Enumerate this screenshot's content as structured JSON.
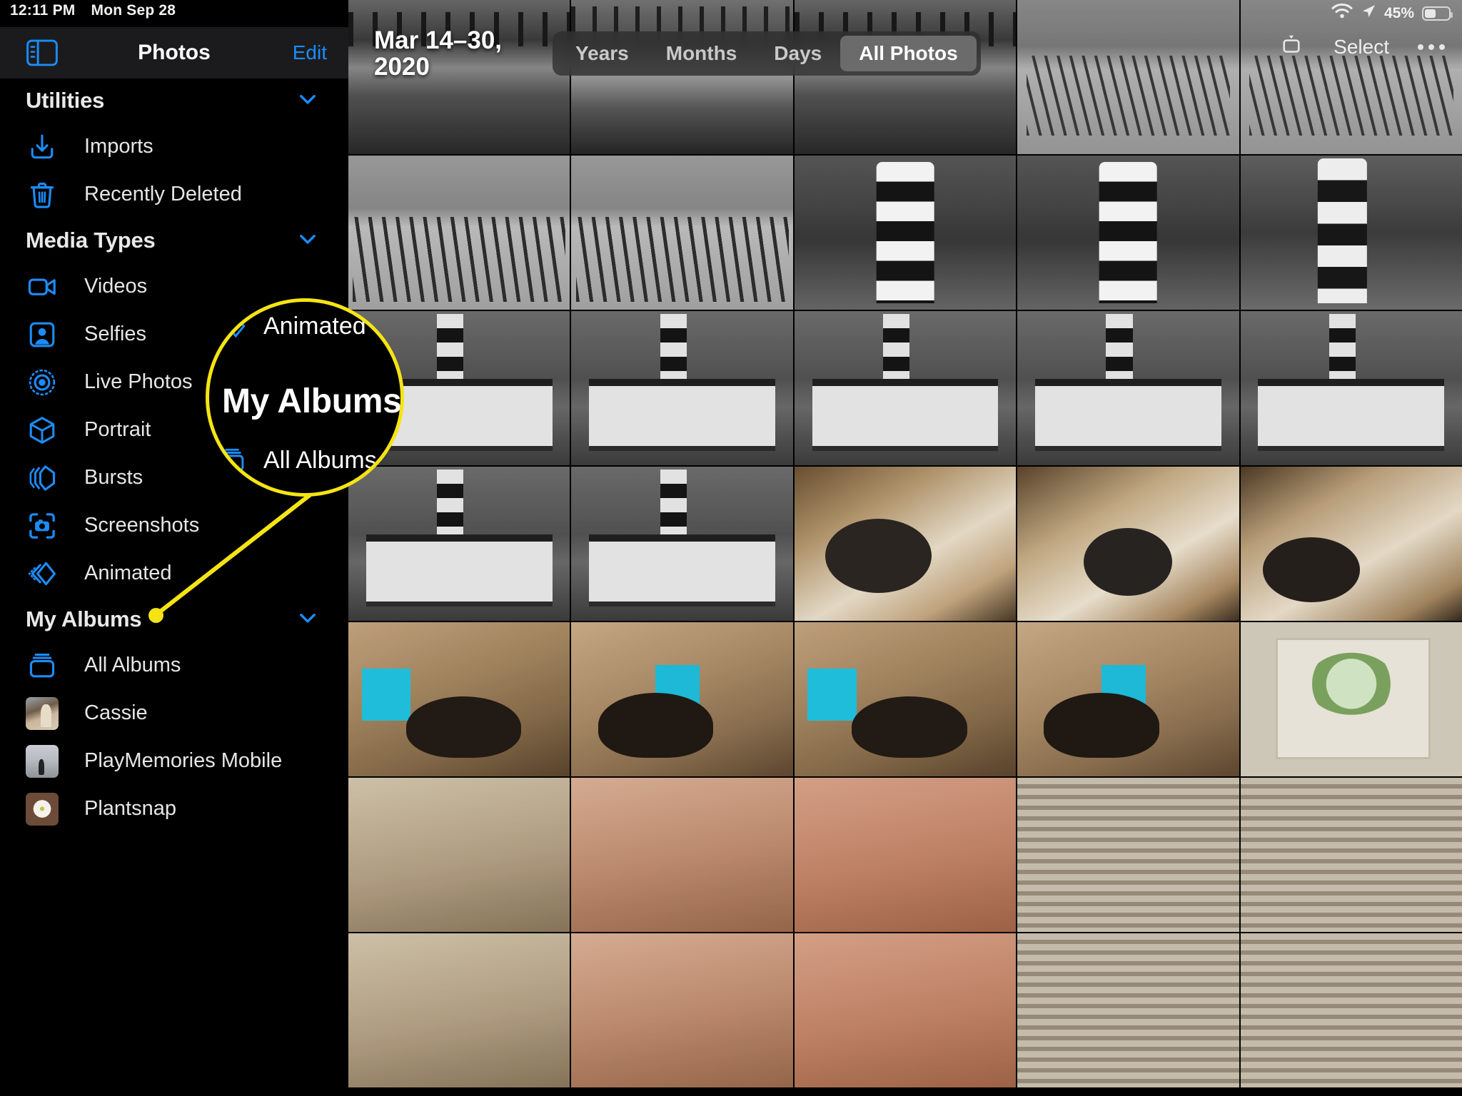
{
  "status_bar": {
    "time": "12:11 PM",
    "date": "Mon Sep 28",
    "battery_percent": "45%",
    "wifi_icon": "wifi-icon",
    "location_icon": "location-arrow-icon",
    "battery_icon": "battery-icon"
  },
  "sidebar": {
    "title": "Photos",
    "edit_label": "Edit",
    "toggle_icon": "sidebar-toggle-icon",
    "sections": [
      {
        "header": "Utilities",
        "chevron": "chevron-down-icon",
        "items": [
          {
            "label": "Imports",
            "icon": "import-tray-icon"
          },
          {
            "label": "Recently Deleted",
            "icon": "trash-icon"
          }
        ]
      },
      {
        "header": "Media Types",
        "chevron": "chevron-down-icon",
        "items": [
          {
            "label": "Videos",
            "icon": "video-camera-icon"
          },
          {
            "label": "Selfies",
            "icon": "person-frame-icon"
          },
          {
            "label": "Live Photos",
            "icon": "live-photo-icon"
          },
          {
            "label": "Portrait",
            "icon": "cube-icon"
          },
          {
            "label": "Bursts",
            "icon": "burst-stack-icon"
          },
          {
            "label": "Screenshots",
            "icon": "screenshot-camera-icon"
          },
          {
            "label": "Animated",
            "icon": "animated-chevrons-icon"
          }
        ]
      },
      {
        "header": "My Albums",
        "chevron": "chevron-down-icon",
        "items": [
          {
            "label": "All Albums",
            "icon": "albums-stack-icon"
          },
          {
            "label": "Cassie",
            "icon": "album-thumbnail"
          },
          {
            "label": "PlayMemories Mobile",
            "icon": "album-thumbnail"
          },
          {
            "label": "Plantsnap",
            "icon": "album-thumbnail"
          }
        ]
      }
    ]
  },
  "toolbar": {
    "date_range_line1": "Mar 14–30,",
    "date_range_line2": "2020",
    "segments": [
      {
        "label": "Years",
        "active": false
      },
      {
        "label": "Months",
        "active": false
      },
      {
        "label": "Days",
        "active": false
      },
      {
        "label": "All Photos",
        "active": true
      }
    ],
    "aspect_icon": "aspect-zoom-icon",
    "select_label": "Select",
    "more_icon": "ellipsis-icon"
  },
  "callout": {
    "magnified_title": "My Albums",
    "magnified_above": "Animated",
    "magnified_below": "All Albums",
    "above_icon": "animated-chevrons-icon",
    "below_icon": "albums-stack-icon",
    "highlight_color": "#f5e414",
    "anchor_target": "My Albums"
  },
  "colors": {
    "accent_blue": "#1c8cf8",
    "background": "#000000",
    "header_bar": "#1b1b1d",
    "active_segment": "#6b6b6b",
    "callout_yellow": "#f5e414"
  },
  "photo_grid": {
    "columns": 5,
    "cells": [
      "ph-pier",
      "ph-pier2",
      "ph-pier",
      "ph-beach",
      "ph-beach",
      "ph-fence",
      "ph-fence",
      "ph-lh",
      "ph-lh",
      "ph-lh2",
      "ph-house",
      "ph-house",
      "ph-house",
      "ph-house",
      "ph-house",
      "ph-house",
      "ph-house",
      "ph-dog",
      "ph-dog2",
      "ph-dog3",
      "ph-cat",
      "ph-cat2",
      "ph-cat",
      "ph-cat2",
      "ph-print",
      "ph-warmA",
      "ph-warmB",
      "ph-warmC",
      "ph-blinds",
      "ph-blinds",
      "ph-warmA",
      "ph-warmB",
      "ph-warmC",
      "ph-blinds",
      "ph-blinds"
    ]
  }
}
